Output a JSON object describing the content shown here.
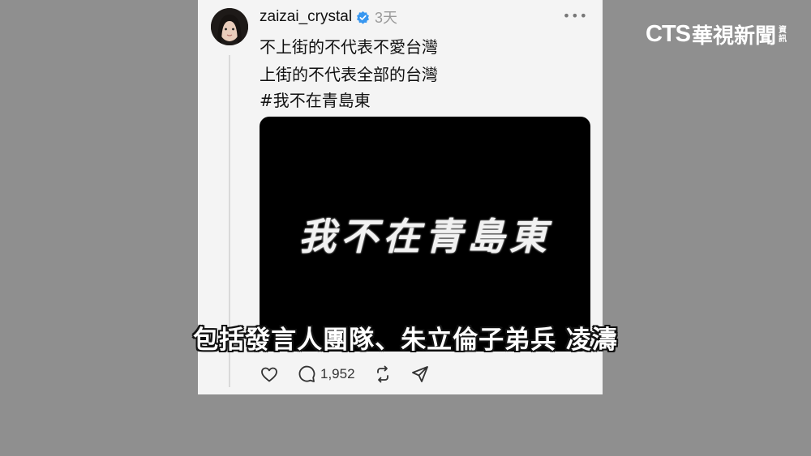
{
  "post": {
    "username": "zaizai_crystal",
    "time": "3天",
    "more_label": "•••",
    "lines": [
      "不上街的不代表不愛台灣",
      "上街的不代表全部的台灣",
      "#我不在青島東"
    ],
    "media_text": "我不在青島東",
    "actions": {
      "like_icon": "heart-icon",
      "comment_icon": "comment-icon",
      "comment_count": "1,952",
      "repost_icon": "repost-icon",
      "share_icon": "send-icon"
    },
    "verified_color": "#3897f0"
  },
  "broadcast": {
    "logo_cts": "CTS",
    "logo_cn": "華視新聞",
    "logo_small": "資訊",
    "subtitle": "包括發言人團隊、朱立倫子弟兵 凌濤"
  }
}
